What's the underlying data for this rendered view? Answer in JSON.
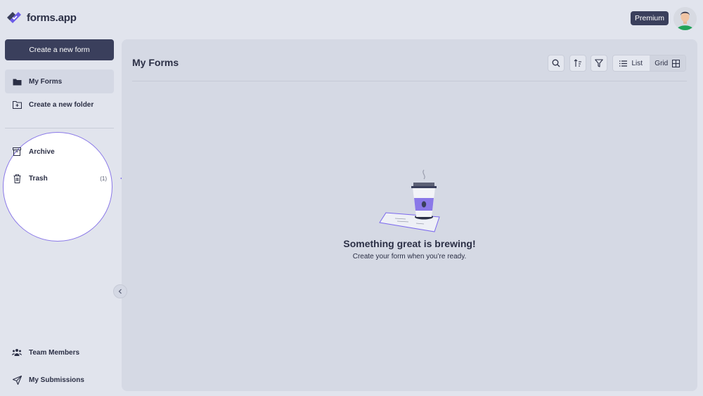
{
  "app": {
    "name": "forms.app",
    "brand_color": "#6c5ce7",
    "dark_color": "#3a3f5c"
  },
  "header": {
    "premium_label": "Premium",
    "avatar_icon": "user-avatar"
  },
  "sidebar": {
    "create_form_label": "Create a new form",
    "items": [
      {
        "label": "My Forms",
        "icon": "folder-icon",
        "active": true
      },
      {
        "label": "Create a new folder",
        "icon": "folder-plus-icon",
        "active": false
      },
      {
        "label": "Archive",
        "icon": "archive-icon",
        "active": false
      },
      {
        "label": "Trash",
        "icon": "trash-icon",
        "count": "(1)",
        "active": false
      },
      {
        "label": "Team Members",
        "icon": "team-icon",
        "active": false
      },
      {
        "label": "My Submissions",
        "icon": "send-icon",
        "active": false
      }
    ],
    "annotation_color": "#8a78e8"
  },
  "main": {
    "title": "My Forms",
    "toolbar": {
      "search_icon": "search-icon",
      "sort_icon": "sort-icon",
      "filter_icon": "filter-icon"
    },
    "view": {
      "list_label": "List",
      "grid_label": "Grid",
      "selected": "Grid"
    },
    "empty_state": {
      "title": "Something great is brewing!",
      "subtitle": "Create your form when you’re ready."
    }
  }
}
